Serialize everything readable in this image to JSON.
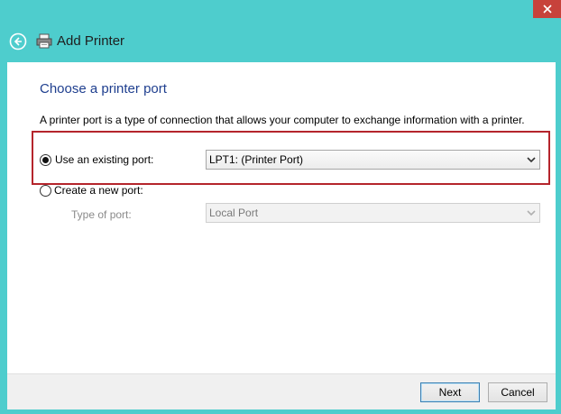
{
  "window": {
    "title": "Add Printer",
    "close_symbol": "✕"
  },
  "page": {
    "heading": "Choose a printer port",
    "description": "A printer port is a type of connection that allows your computer to exchange information with a printer."
  },
  "options": {
    "existing": {
      "label": "Use an existing port:",
      "selected": true,
      "value": "LPT1: (Printer Port)"
    },
    "create_new": {
      "label": "Create a new port:",
      "selected": false,
      "type_label": "Type of port:",
      "type_value": "Local Port"
    }
  },
  "buttons": {
    "next": "Next",
    "cancel": "Cancel"
  },
  "icons": {
    "back": "back-arrow-icon",
    "printer": "printer-icon",
    "close": "close-icon",
    "chevron": "chevron-down-icon"
  },
  "colors": {
    "desktop": "#4ecdcd",
    "close_button": "#c7423b",
    "heading": "#1f3f8f",
    "highlight": "#b5252c"
  }
}
